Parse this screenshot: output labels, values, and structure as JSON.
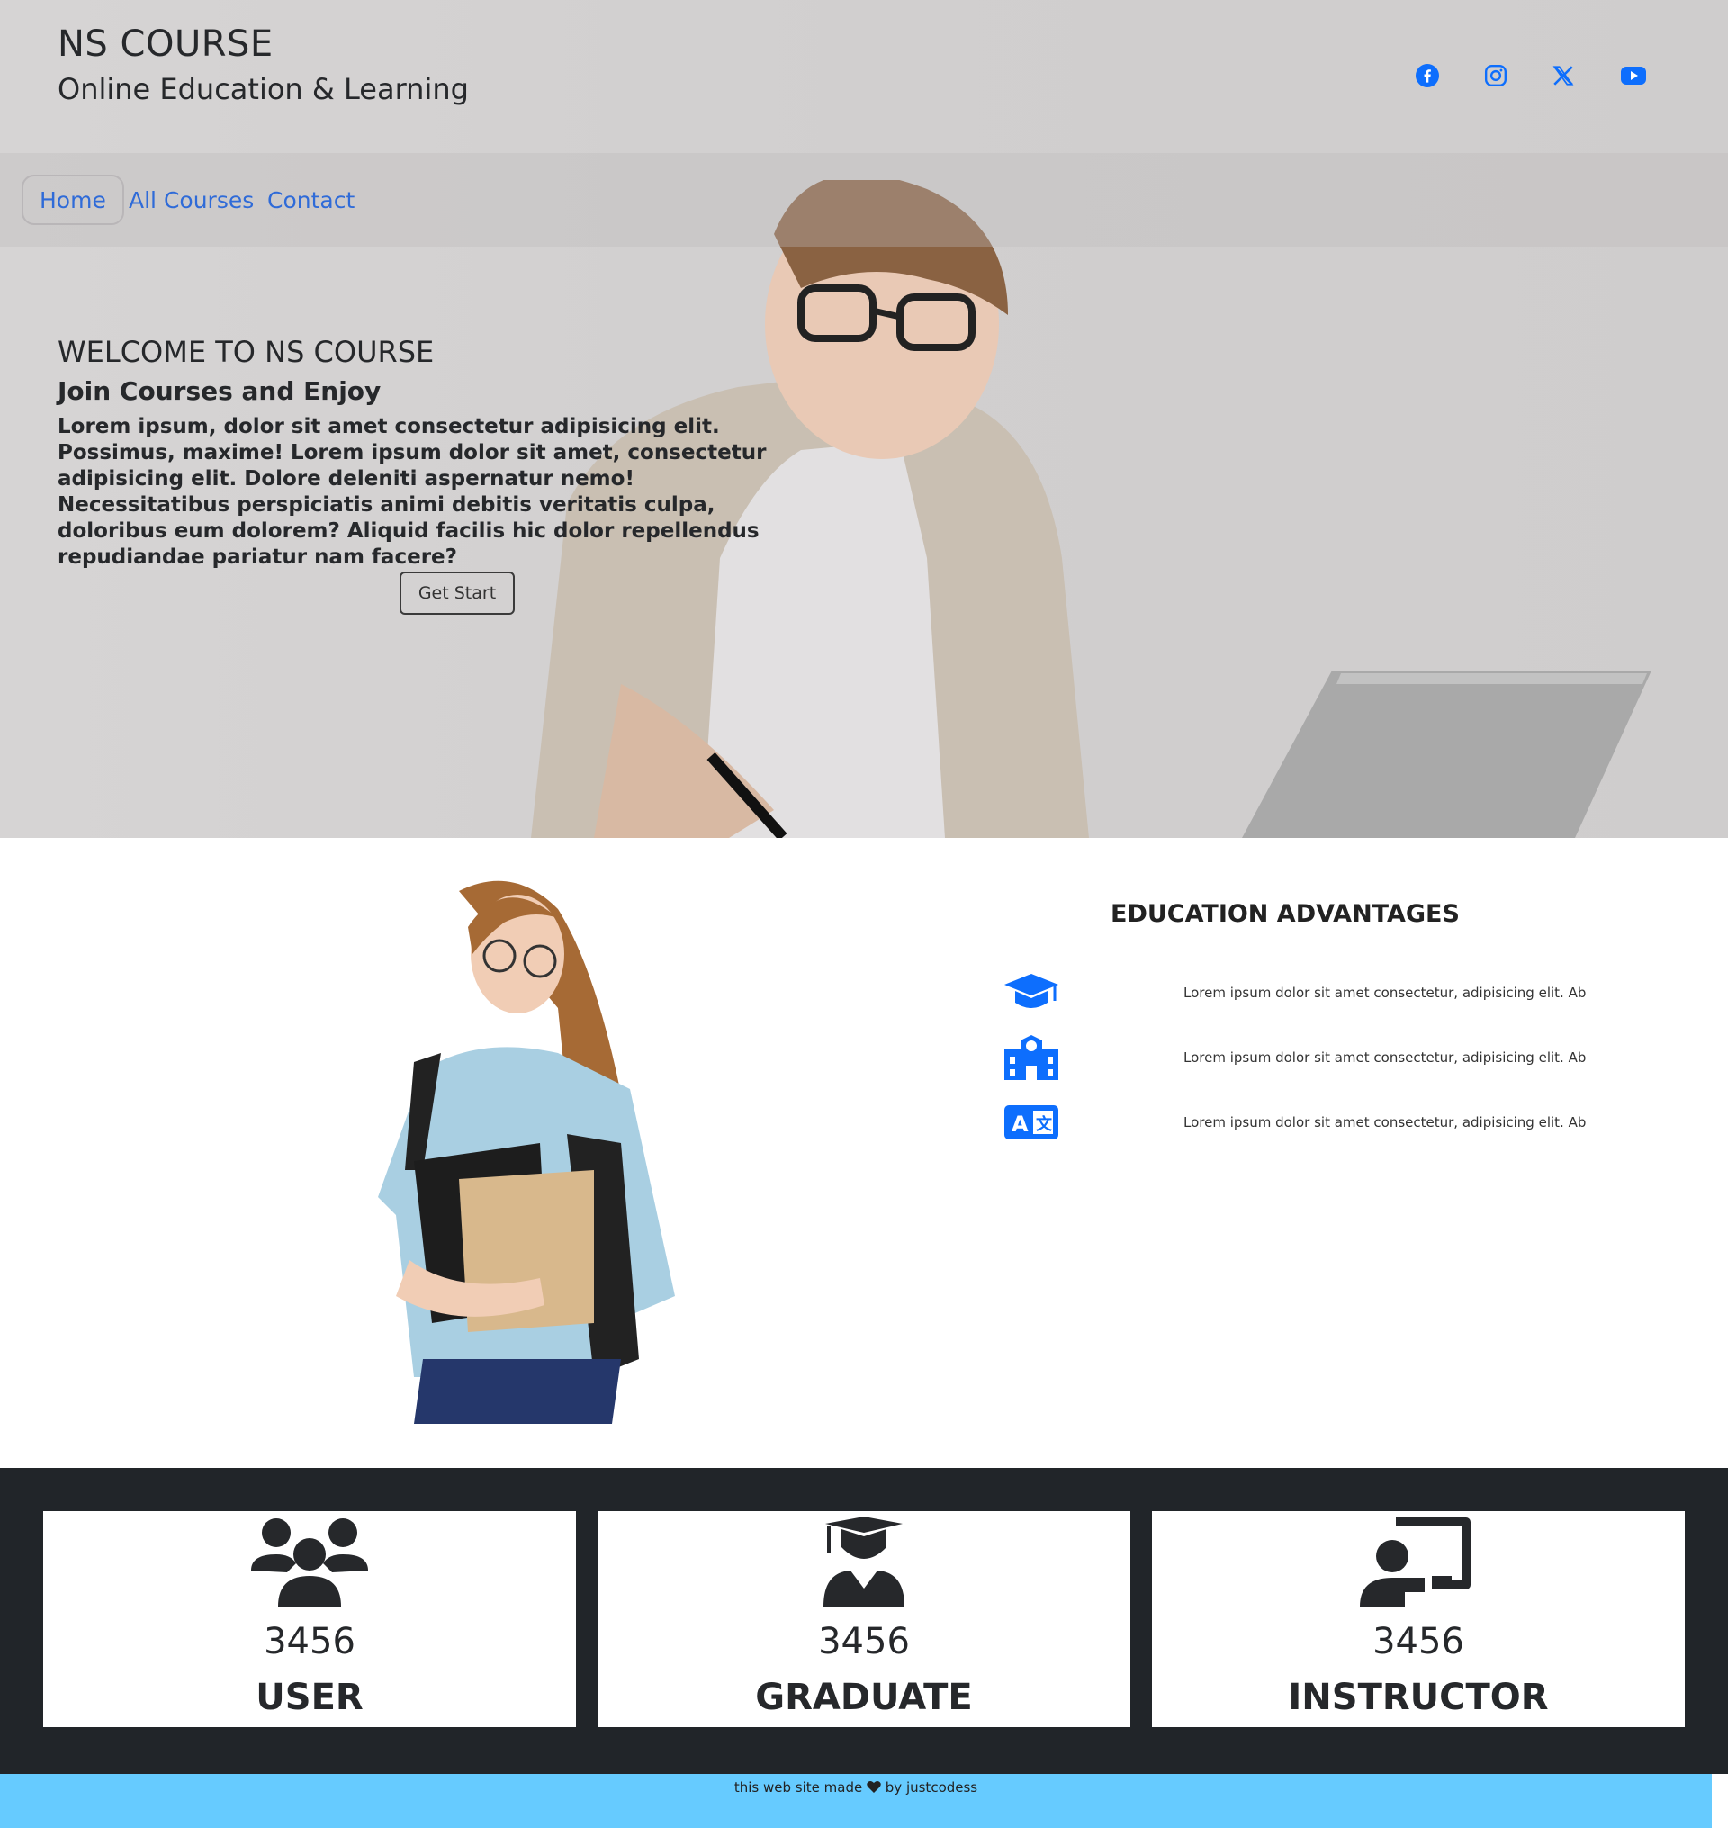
{
  "header": {
    "title": "NS COURSE",
    "subtitle": "Online Education & Learning",
    "social_icons": [
      "facebook-icon",
      "instagram-icon",
      "x-icon",
      "youtube-icon"
    ]
  },
  "nav": {
    "home": "Home",
    "courses": "All Courses",
    "contact": "Contact"
  },
  "hero": {
    "heading": "WELCOME TO NS COURSE",
    "subheading": "Join Courses and Enjoy",
    "paragraph": "Lorem ipsum, dolor sit amet consectetur adipisicing elit. Possimus, maxime! Lorem ipsum dolor sit amet, consectetur adipisicing elit. Dolore deleniti aspernatur nemo! Necessitatibus perspiciatis animi debitis veritatis culpa, doloribus eum dolorem? Aliquid facilis hic dolor repellendus repudiandae pariatur nam facere?",
    "button": "Get Start"
  },
  "advantages": {
    "title": "EDUCATION ADVANTAGES",
    "items": [
      {
        "icon": "graduation-cap-icon",
        "text": "Lorem ipsum dolor sit amet consectetur, adipisicing elit. Ab"
      },
      {
        "icon": "school-building-icon",
        "text": "Lorem ipsum dolor sit amet consectetur, adipisicing elit. Ab"
      },
      {
        "icon": "translate-icon",
        "text": "Lorem ipsum dolor sit amet consectetur, adipisicing elit. Ab"
      }
    ]
  },
  "stats": [
    {
      "icon": "users-icon",
      "value": "3456",
      "label": "USER"
    },
    {
      "icon": "graduate-icon",
      "value": "3456",
      "label": "GRADUATE"
    },
    {
      "icon": "instructor-icon",
      "value": "3456",
      "label": "INSTRUCTOR"
    }
  ],
  "footer": {
    "text_before": "this web site made",
    "text_after": "by justcodess"
  },
  "colors": {
    "accent": "#0d6efd",
    "dark": "#212529",
    "footer": "#66cbff"
  }
}
